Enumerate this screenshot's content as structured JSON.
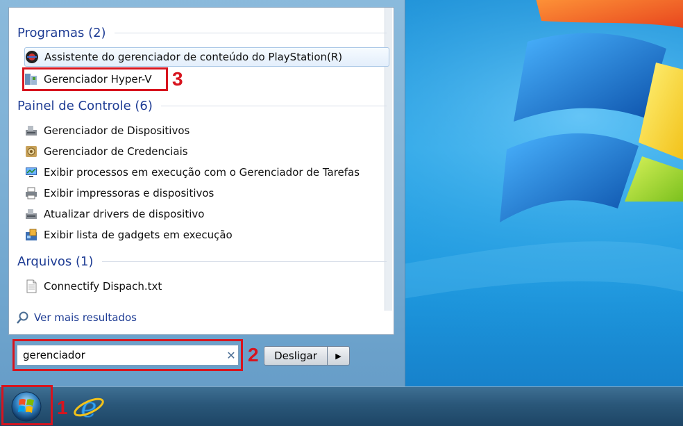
{
  "start_menu": {
    "groups": [
      {
        "header": "Programas (2)",
        "items": [
          {
            "label": "Assistente do gerenciador de conteúdo do PlayStation(R)",
            "icon": "playstation-icon"
          },
          {
            "label": "Gerenciador Hyper-V",
            "icon": "hyperv-icon"
          }
        ]
      },
      {
        "header": "Painel de Controle (6)",
        "items": [
          {
            "label": "Gerenciador de Dispositivos",
            "icon": "device-manager-icon"
          },
          {
            "label": "Gerenciador de Credenciais",
            "icon": "credential-vault-icon"
          },
          {
            "label": "Exibir processos em execução com o Gerenciador de Tarefas",
            "icon": "task-manager-icon"
          },
          {
            "label": "Exibir impressoras e dispositivos",
            "icon": "printer-icon"
          },
          {
            "label": "Atualizar drivers de dispositivo",
            "icon": "device-manager-icon"
          },
          {
            "label": "Exibir lista de gadgets em execução",
            "icon": "gadgets-icon"
          }
        ]
      },
      {
        "header": "Arquivos (1)",
        "items": [
          {
            "label": "Connectify Dispach.txt",
            "icon": "text-file-icon"
          }
        ]
      }
    ],
    "see_more": "Ver mais resultados",
    "search": {
      "value": "gerenciador",
      "clear_icon": "clear-icon"
    },
    "shutdown_label": "Desligar",
    "shutdown_arrow_icon": "arrow-right-icon"
  },
  "annotations": {
    "one": "1",
    "two": "2",
    "three": "3"
  },
  "taskbar": {
    "start_orb_icon": "windows-orb-icon",
    "pinned": [
      "internet-explorer-icon"
    ]
  },
  "colors": {
    "annotation_red": "#d7141e",
    "header_blue": "#1e3c94",
    "link_blue": "#1e3c94"
  }
}
